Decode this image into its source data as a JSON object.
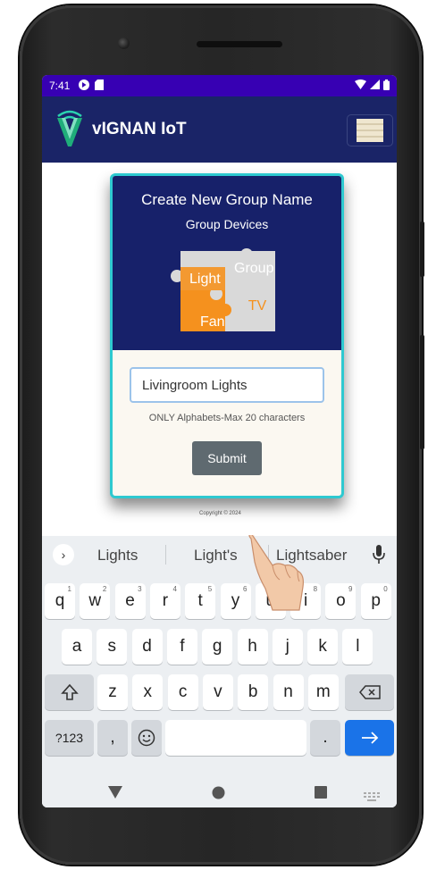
{
  "status_bar": {
    "time": "7:41"
  },
  "app_bar": {
    "title": "vIGNAN IoT"
  },
  "card": {
    "title": "Create New Group Name",
    "subtitle": "Group Devices",
    "illustration": {
      "group": "Group",
      "light": "Light",
      "tv": "TV",
      "fan": "Fan"
    },
    "name_input_value": "Livingroom Lights",
    "hint": "ONLY Alphabets-Max 20 characters",
    "submit_label": "Submit"
  },
  "copyright": "Copyright © 2024",
  "keyboard": {
    "suggestions": [
      "Lights",
      "Light's",
      "Lightsaber"
    ],
    "row1": [
      {
        "k": "q",
        "n": "1"
      },
      {
        "k": "w",
        "n": "2"
      },
      {
        "k": "e",
        "n": "3"
      },
      {
        "k": "r",
        "n": "4"
      },
      {
        "k": "t",
        "n": "5"
      },
      {
        "k": "y",
        "n": "6"
      },
      {
        "k": "u",
        "n": "7"
      },
      {
        "k": "i",
        "n": "8"
      },
      {
        "k": "o",
        "n": "9"
      },
      {
        "k": "p",
        "n": "0"
      }
    ],
    "row2": [
      "a",
      "s",
      "d",
      "f",
      "g",
      "h",
      "j",
      "k",
      "l"
    ],
    "row3": [
      "z",
      "x",
      "c",
      "v",
      "b",
      "n",
      "m"
    ],
    "symbols_label": "?123",
    "comma": ",",
    "period": ".",
    "accent_color": "#1a73e8"
  },
  "colors": {
    "status_bar": "#3700b3",
    "app_bar": "#1a2467",
    "card_border": "#2ec9d0",
    "submit": "#5f6a70"
  }
}
